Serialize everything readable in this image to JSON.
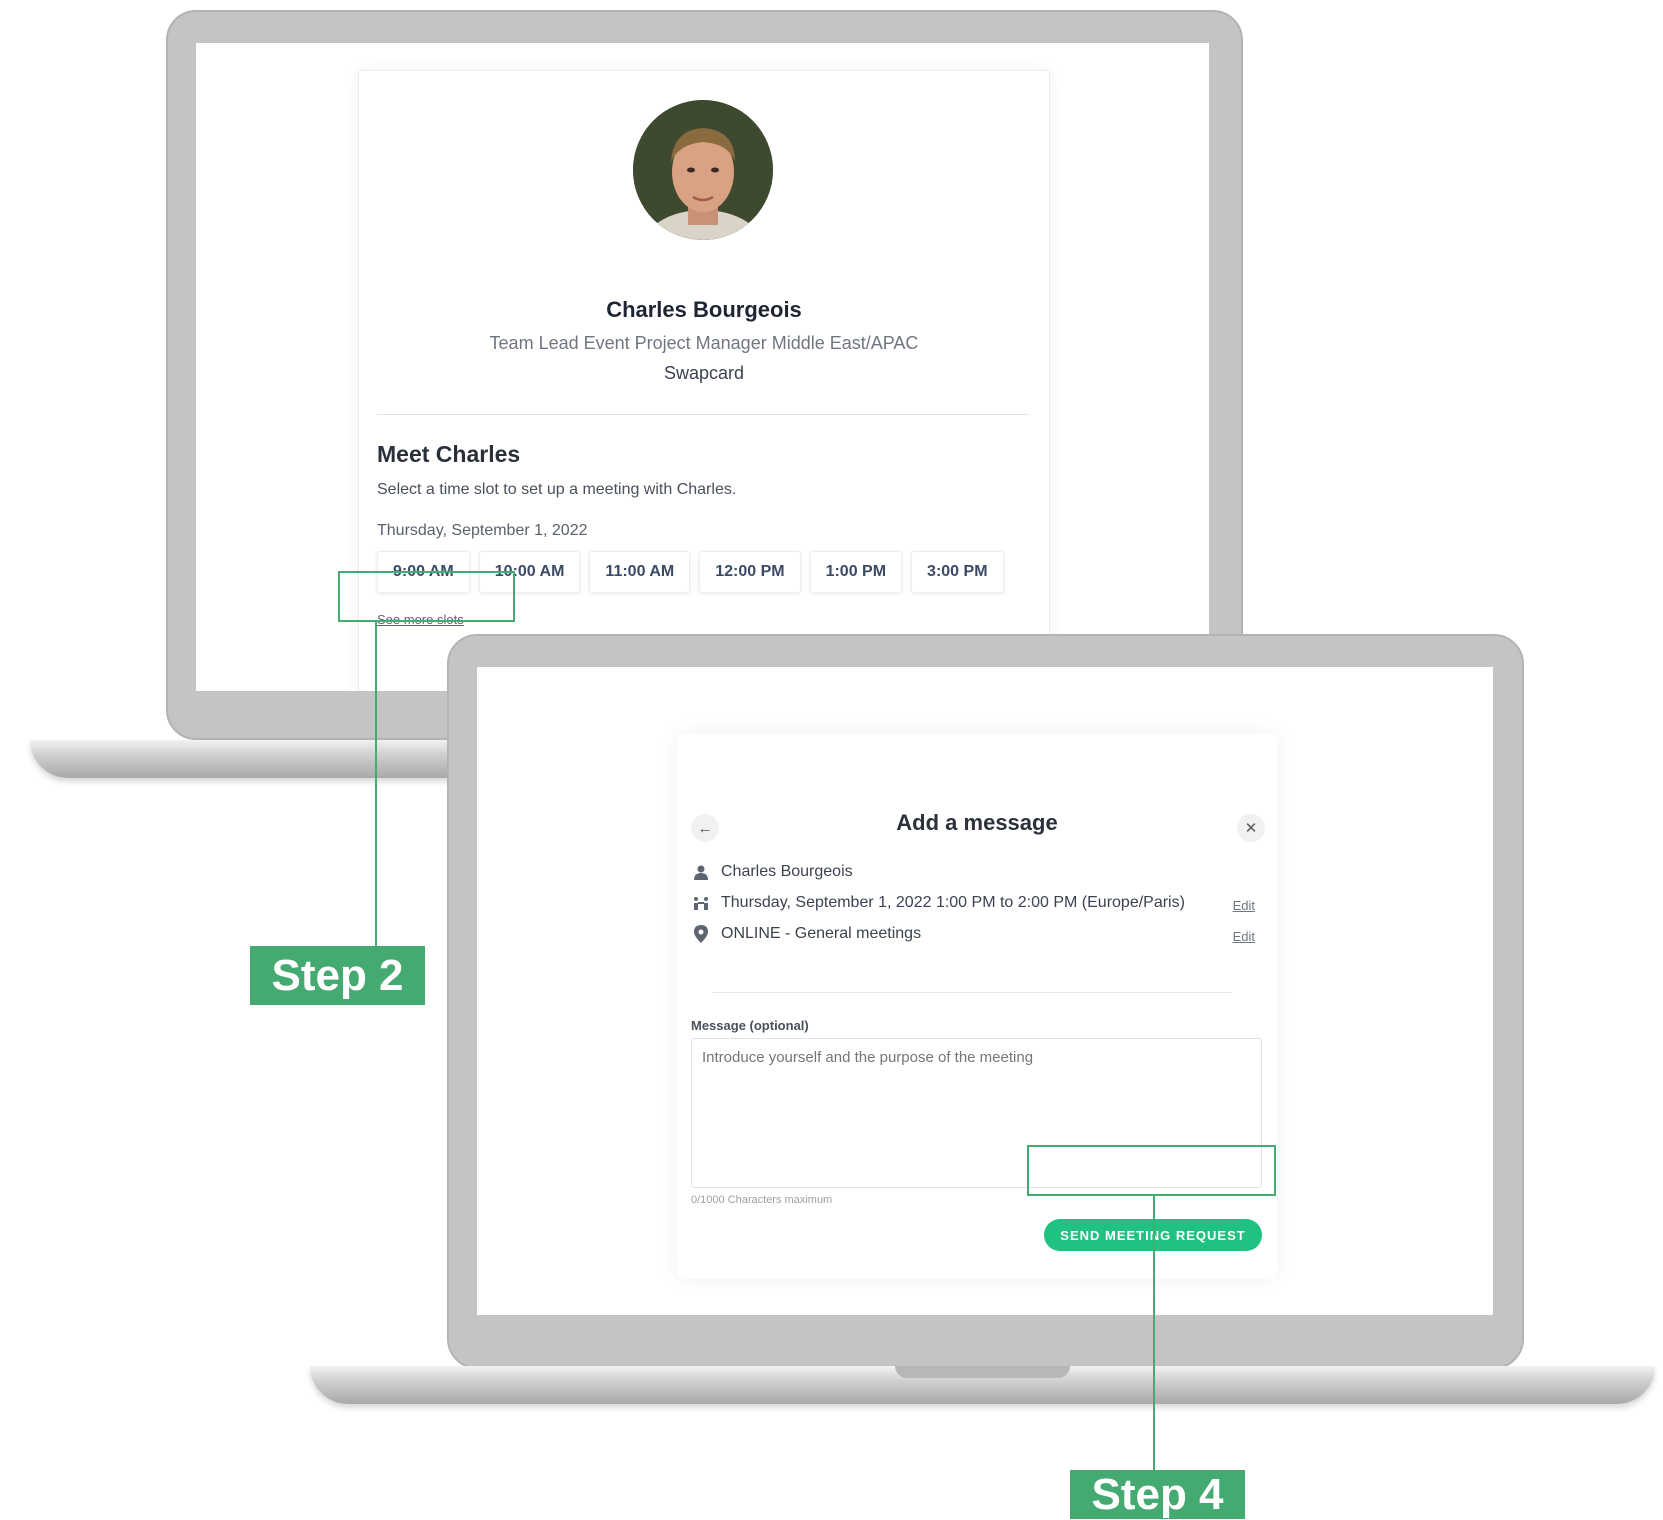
{
  "profile": {
    "name": "Charles Bourgeois",
    "job_title": "Team Lead Event Project Manager Middle East/APAC",
    "company": "Swapcard"
  },
  "meet": {
    "heading": "Meet Charles",
    "instruction": "Select a time slot to set up a meeting with Charles.",
    "date": "Thursday, September 1, 2022",
    "slots": [
      "9:00 AM",
      "10:00 AM",
      "11:00 AM",
      "12:00 PM",
      "1:00 PM",
      "3:00 PM"
    ],
    "see_more": "See more slots"
  },
  "modal": {
    "title": "Add a message",
    "back_icon": "arrow-left-icon",
    "close_icon": "close-icon",
    "attendee": "Charles Bourgeois",
    "datetime": "Thursday, September 1, 2022 1:00 PM to 2:00 PM (Europe/Paris)",
    "location": "ONLINE - General meetings",
    "edit_label": "Edit",
    "message_label": "Message (optional)",
    "message_placeholder": "Introduce yourself and the purpose of the meeting",
    "counter": "0/1000 Characters maximum",
    "send_button": "SEND MEETING REQUEST"
  },
  "annotations": {
    "step2": "Step 2",
    "step4": "Step 4",
    "color": "#45aa71"
  },
  "colors": {
    "accent": "#1fc281",
    "laptop_bezel": "#c4c4c4"
  }
}
